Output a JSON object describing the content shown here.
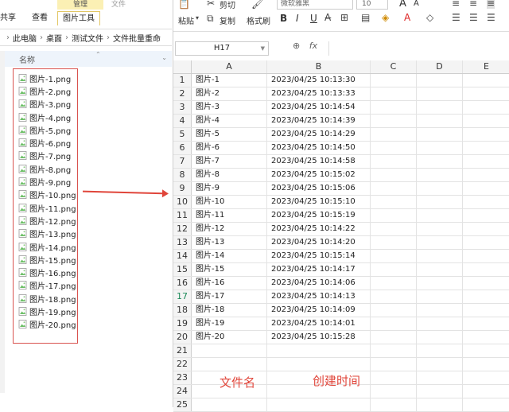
{
  "explorer": {
    "context_group": "管理",
    "context_extra": "文件",
    "tabs": [
      "共享",
      "查看",
      "图片工具"
    ],
    "address": [
      "此电脑",
      "桌面",
      "测试文件",
      "文件批量重命"
    ],
    "column_header": "名称",
    "files": [
      "图片-1.png",
      "图片-2.png",
      "图片-3.png",
      "图片-4.png",
      "图片-5.png",
      "图片-6.png",
      "图片-7.png",
      "图片-8.png",
      "图片-9.png",
      "图片-10.png",
      "图片-11.png",
      "图片-12.png",
      "图片-13.png",
      "图片-14.png",
      "图片-15.png",
      "图片-16.png",
      "图片-17.png",
      "图片-18.png",
      "图片-19.png",
      "图片-20.png"
    ]
  },
  "ribbon": {
    "paste": "粘贴",
    "cut": "剪切",
    "copy": "复制",
    "format_painter": "格式刷",
    "font_name": "微软雅黑",
    "font_size": "10",
    "bold": "B",
    "italic": "I",
    "underline": "U",
    "grow_font": "A",
    "shrink_font": "A"
  },
  "formula_bar": {
    "name_box": "H17",
    "fx": "fx"
  },
  "sheet": {
    "columns": [
      "A",
      "B",
      "C",
      "D",
      "E"
    ],
    "selected_row": "17",
    "rows": [
      {
        "n": "1",
        "a": "图片-1",
        "b": "2023/04/25 10:13:30"
      },
      {
        "n": "2",
        "a": "图片-2",
        "b": "2023/04/25 10:13:33"
      },
      {
        "n": "3",
        "a": "图片-3",
        "b": "2023/04/25 10:14:54"
      },
      {
        "n": "4",
        "a": "图片-4",
        "b": "2023/04/25 10:14:39"
      },
      {
        "n": "5",
        "a": "图片-5",
        "b": "2023/04/25 10:14:29"
      },
      {
        "n": "6",
        "a": "图片-6",
        "b": "2023/04/25 10:14:50"
      },
      {
        "n": "7",
        "a": "图片-7",
        "b": "2023/04/25 10:14:58"
      },
      {
        "n": "8",
        "a": "图片-8",
        "b": "2023/04/25 10:15:02"
      },
      {
        "n": "9",
        "a": "图片-9",
        "b": "2023/04/25 10:15:06"
      },
      {
        "n": "10",
        "a": "图片-10",
        "b": "2023/04/25 10:15:10"
      },
      {
        "n": "11",
        "a": "图片-11",
        "b": "2023/04/25 10:15:19"
      },
      {
        "n": "12",
        "a": "图片-12",
        "b": "2023/04/25 10:14:22"
      },
      {
        "n": "13",
        "a": "图片-13",
        "b": "2023/04/25 10:14:20"
      },
      {
        "n": "14",
        "a": "图片-14",
        "b": "2023/04/25 10:15:14"
      },
      {
        "n": "15",
        "a": "图片-15",
        "b": "2023/04/25 10:14:17"
      },
      {
        "n": "16",
        "a": "图片-16",
        "b": "2023/04/25 10:14:06"
      },
      {
        "n": "17",
        "a": "图片-17",
        "b": "2023/04/25 10:14:13"
      },
      {
        "n": "18",
        "a": "图片-18",
        "b": "2023/04/25 10:14:09"
      },
      {
        "n": "19",
        "a": "图片-19",
        "b": "2023/04/25 10:14:01"
      },
      {
        "n": "20",
        "a": "图片-20",
        "b": "2023/04/25 10:15:28"
      },
      {
        "n": "21",
        "a": "",
        "b": ""
      },
      {
        "n": "22",
        "a": "",
        "b": ""
      },
      {
        "n": "23",
        "a": "",
        "b": ""
      },
      {
        "n": "24",
        "a": "",
        "b": ""
      },
      {
        "n": "25",
        "a": "",
        "b": ""
      }
    ]
  },
  "annotations": {
    "file_name": "文件名",
    "created_time": "创建时间"
  },
  "colors": {
    "arrow": "#e0453a",
    "file_icon": "#6dbf67",
    "selected_row": "#1e8a5a"
  }
}
